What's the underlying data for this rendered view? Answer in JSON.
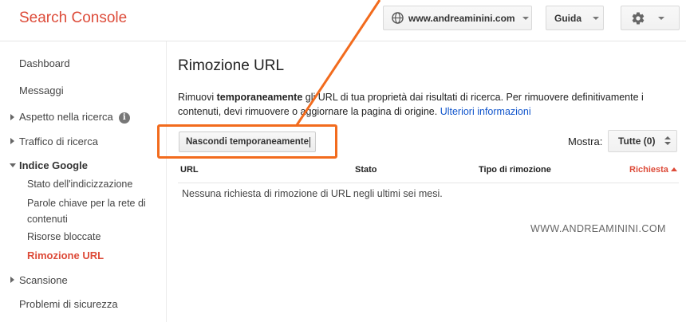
{
  "header": {
    "brand": "Search Console",
    "site": "www.andreaminini.com",
    "help": "Guida"
  },
  "sidebar": {
    "items": [
      {
        "label": "Dashboard"
      },
      {
        "label": "Messaggi"
      },
      {
        "label": "Aspetto nella ricerca"
      },
      {
        "label": "Traffico di ricerca"
      },
      {
        "label": "Indice Google"
      },
      {
        "label": "Scansione"
      },
      {
        "label": "Problemi di sicurezza"
      }
    ],
    "subitems": [
      {
        "label": "Stato dell'indicizzazione"
      },
      {
        "label": "Parole chiave per la rete di contenuti"
      },
      {
        "label": "Risorse bloccate"
      },
      {
        "label": "Rimozione URL"
      }
    ]
  },
  "main": {
    "title": "Rimozione URL",
    "desc_part1": "Rimuovi ",
    "desc_bold": "temporaneamente",
    "desc_part2": " gli URL di tua proprietà dai risultati di ricerca. Per rimuovere definitivamente i contenuti, devi rimuovere o aggiornare la pagina di origine. ",
    "desc_link": "Ulteriori informazioni",
    "hide_button": "Nascondi temporaneamente",
    "show_label": "Mostra:",
    "show_value": "Tutte (0)",
    "columns": [
      "URL",
      "Stato",
      "Tipo di rimozione",
      "Richiesta"
    ],
    "empty_message": "Nessuna richiesta di rimozione di URL negli ultimi sei mesi.",
    "watermark": "WWW.ANDREAMININI.COM"
  },
  "colors": {
    "brand": "#dd4b39",
    "link": "#1155cc",
    "highlight": "#f26b1d"
  }
}
